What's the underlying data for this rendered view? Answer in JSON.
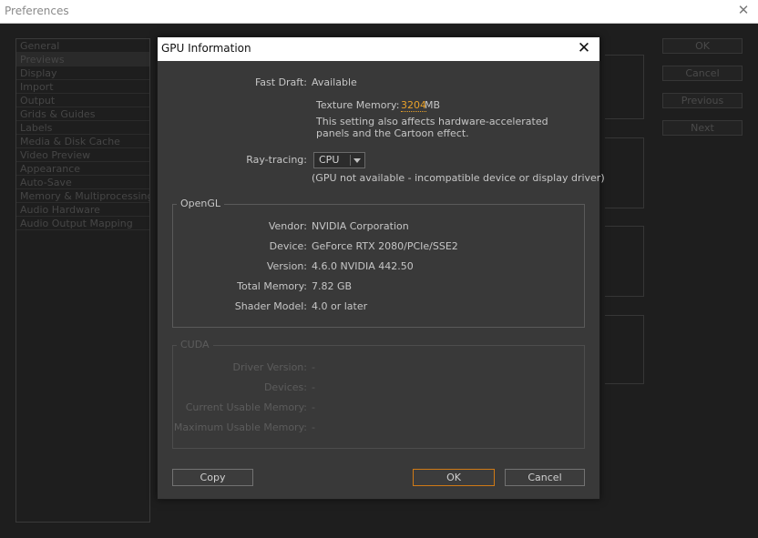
{
  "preferences": {
    "title": "Preferences",
    "nav": [
      "General",
      "Previews",
      "Display",
      "Import",
      "Output",
      "Grids & Guides",
      "Labels",
      "Media & Disk Cache",
      "Video Preview",
      "Appearance",
      "Auto-Save",
      "Memory & Multiprocessing",
      "Audio Hardware",
      "Audio Output Mapping"
    ],
    "selected_nav": "Previews",
    "buttons": {
      "ok": "OK",
      "cancel": "Cancel",
      "previous": "Previous",
      "next": "Next"
    }
  },
  "dialog": {
    "title": "GPU Information",
    "fast_draft": {
      "label": "Fast Draft:",
      "value": "Available"
    },
    "texture_memory": {
      "label": "Texture Memory:",
      "value": "3204",
      "unit": "MB"
    },
    "note_line1": "This setting also affects hardware-accelerated",
    "note_line2": "panels and the Cartoon effect.",
    "ray_tracing": {
      "label": "Ray-tracing:",
      "value": "CPU",
      "note": "(GPU not available - incompatible device or display driver)"
    },
    "opengl": {
      "legend": "OpenGL",
      "rows": [
        {
          "label": "Vendor:",
          "value": "NVIDIA Corporation"
        },
        {
          "label": "Device:",
          "value": "GeForce RTX 2080/PCIe/SSE2"
        },
        {
          "label": "Version:",
          "value": "4.6.0 NVIDIA 442.50"
        },
        {
          "label": "Total Memory:",
          "value": "7.82 GB"
        },
        {
          "label": "Shader Model:",
          "value": "4.0 or later"
        }
      ]
    },
    "cuda": {
      "legend": "CUDA",
      "rows": [
        {
          "label": "Driver Version:",
          "value": "-"
        },
        {
          "label": "Devices:",
          "value": "-"
        },
        {
          "label": "Current Usable Memory:",
          "value": "-"
        },
        {
          "label": "Maximum Usable Memory:",
          "value": "-"
        }
      ]
    },
    "buttons": {
      "copy": "Copy",
      "ok": "OK",
      "cancel": "Cancel"
    }
  },
  "colors": {
    "accent": "#e8a12a",
    "default_button_border": "#d07a16",
    "dialog_bg": "#393939"
  }
}
